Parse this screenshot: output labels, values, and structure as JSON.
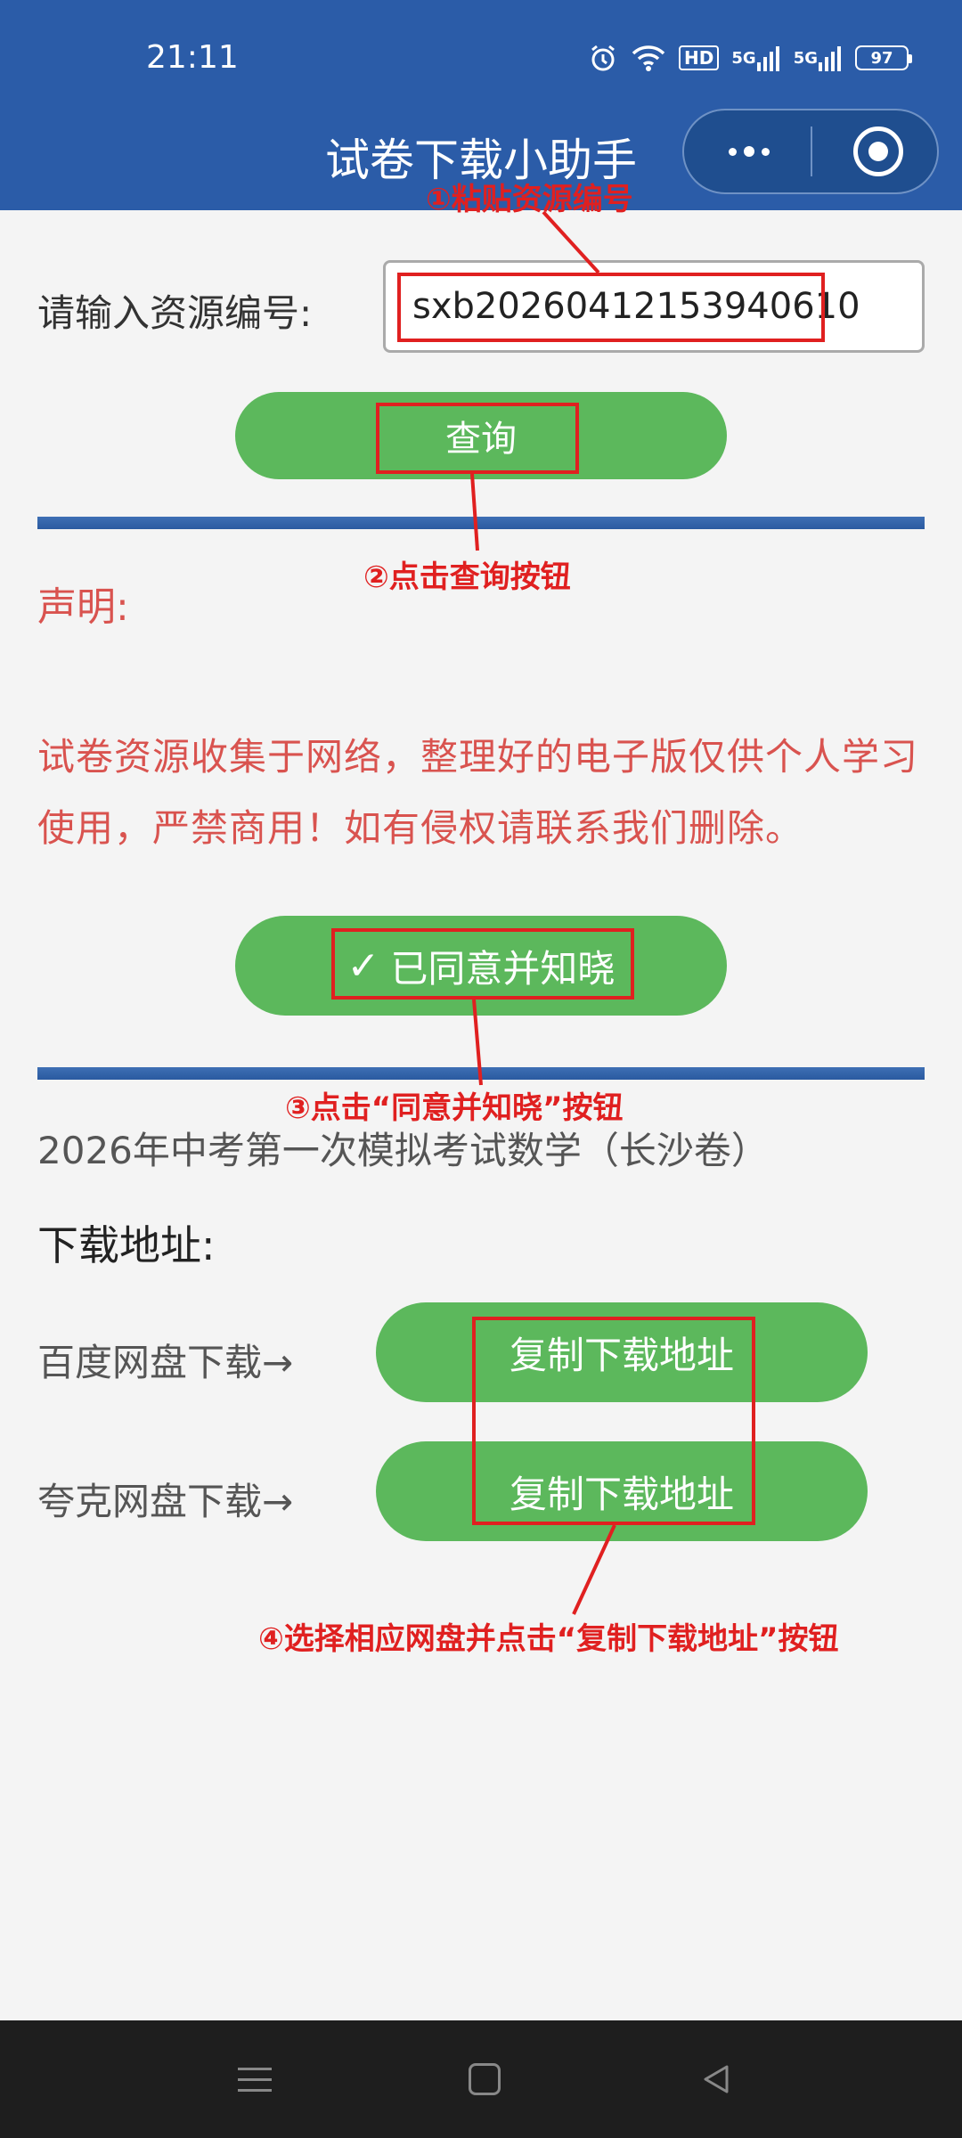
{
  "status_bar": {
    "time": "21:11",
    "hd_label": "HD",
    "sig1_label": "5G",
    "sig2_label": "5G",
    "battery": "97"
  },
  "header": {
    "title": "试卷下载小助手"
  },
  "form": {
    "input_label": "请输入资源编号:",
    "resource_value": "sxb20260412153940610",
    "query_label": "查询"
  },
  "statement": {
    "title": "声明:",
    "text": "试卷资源收集于网络，整理好的电子版仅供个人学习使用，严禁商用！如有侵权请联系我们删除。",
    "agree_label": "已同意并知晓"
  },
  "result": {
    "exam_title": "2026年中考第一次模拟考试数学（长沙卷）",
    "download_label": "下载地址:",
    "rows": [
      {
        "label": "百度网盘下载→",
        "button": "复制下载地址"
      },
      {
        "label": "夸克网盘下载→",
        "button": "复制下载地址"
      }
    ]
  },
  "annotations": {
    "step1": "①粘贴资源编号",
    "step2": "②点击查询按钮",
    "step3": "③点击“同意并知晓”按钮",
    "step4": "④选择相应网盘并点击“复制下载地址”按钮"
  },
  "colors": {
    "header": "#2b5ca8",
    "button_green": "#5cb85c",
    "statement_red": "#d9534f",
    "annotation_red": "#e02020"
  }
}
